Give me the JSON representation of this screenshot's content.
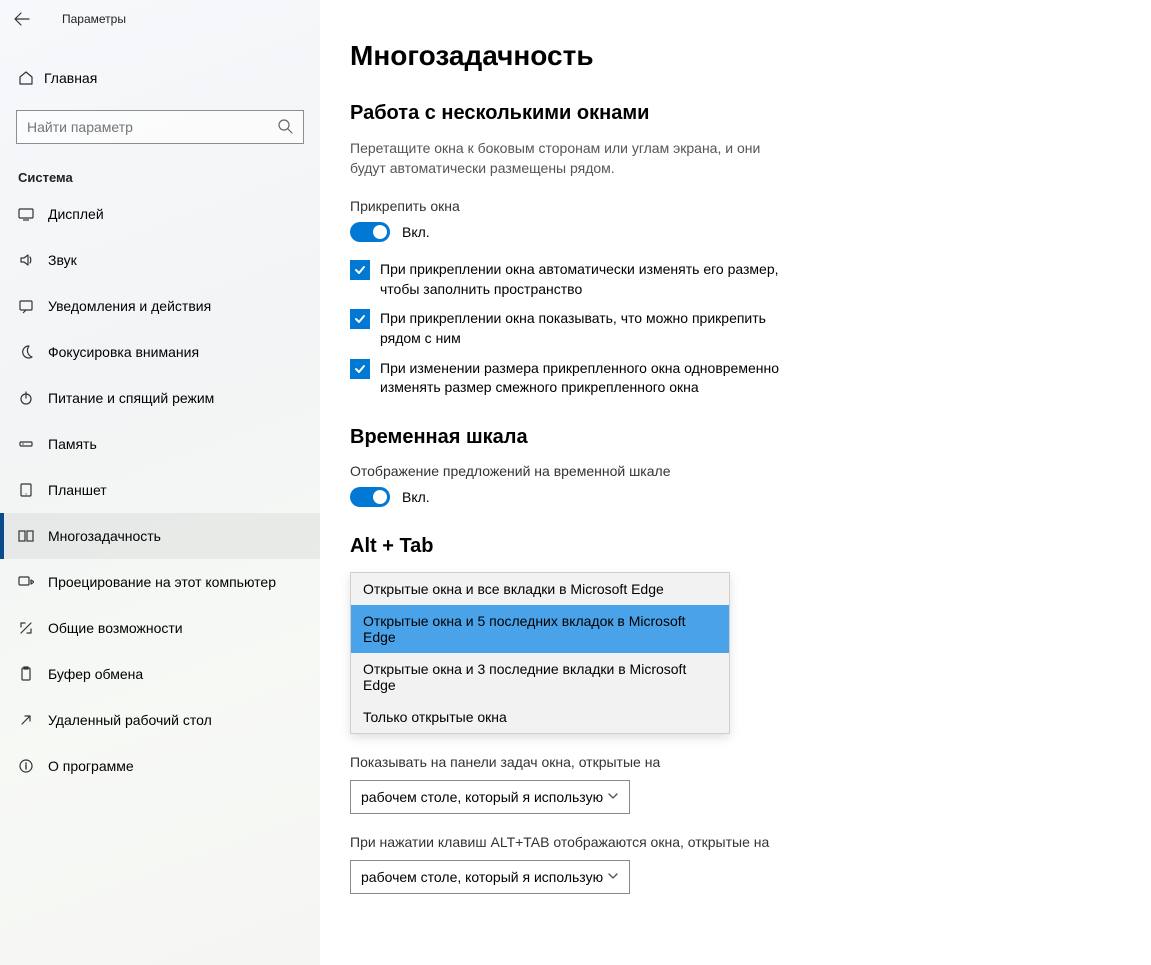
{
  "window_title": "Параметры",
  "home_label": "Главная",
  "search_placeholder": "Найти параметр",
  "sidebar_group": "Система",
  "sidebar": {
    "items": [
      {
        "label": "Дисплей"
      },
      {
        "label": "Звук"
      },
      {
        "label": "Уведомления и действия"
      },
      {
        "label": "Фокусировка внимания"
      },
      {
        "label": "Питание и спящий режим"
      },
      {
        "label": "Память"
      },
      {
        "label": "Планшет"
      },
      {
        "label": "Многозадачность"
      },
      {
        "label": "Проецирование на этот компьютер"
      },
      {
        "label": "Общие возможности"
      },
      {
        "label": "Буфер обмена"
      },
      {
        "label": "Удаленный рабочий стол"
      },
      {
        "label": "О программе"
      }
    ]
  },
  "page_title": "Многозадачность",
  "section_snap": {
    "heading": "Работа с несколькими окнами",
    "desc": "Перетащите окна к боковым сторонам или углам экрана, и они будут автоматически размещены рядом.",
    "toggle_caption": "Прикрепить окна",
    "toggle_state": "Вкл.",
    "checks": [
      "При прикреплении окна автоматически изменять его размер, чтобы заполнить пространство",
      "При прикреплении окна показывать, что можно прикрепить рядом с ним",
      "При изменении размера прикрепленного окна одновременно изменять размер смежного прикрепленного окна"
    ]
  },
  "section_timeline": {
    "heading": "Временная шкала",
    "desc": "Отображение предложений на временной шкале",
    "toggle_state": "Вкл."
  },
  "section_alttab": {
    "heading": "Alt + Tab",
    "options": [
      "Открытые окна и все вкладки в Microsoft Edge",
      "Открытые окна и 5 последних вкладок в Microsoft Edge",
      "Открытые окна и 3 последние вкладки в Microsoft Edge",
      "Только открытые окна"
    ],
    "selected_index": 1
  },
  "section_vd1": {
    "label": "Показывать на панели задач окна, открытые на",
    "value": "рабочем столе, который я использую"
  },
  "section_vd2": {
    "label": "При нажатии клавиш ALT+TAB отображаются окна, открытые на",
    "value": "рабочем столе, который я использую"
  }
}
